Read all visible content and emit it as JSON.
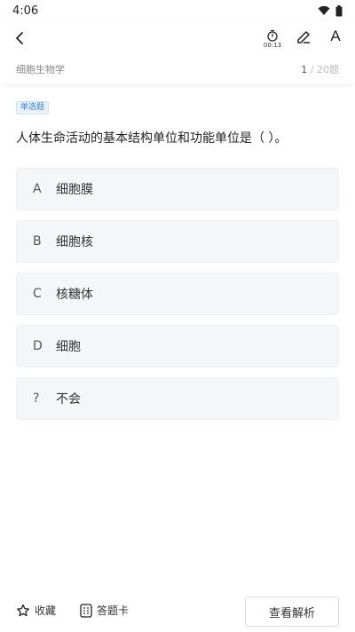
{
  "status_bar": {
    "time": "4:06"
  },
  "header": {
    "timer": "00:13",
    "font_label": "A",
    "subject": "细胞生物学",
    "progress_current": "1",
    "progress_total": " / 20题"
  },
  "question": {
    "type_label": "单选题",
    "text": "人体生命活动的基本结构单位和功能单位是（ ）。",
    "options": [
      {
        "key": "A",
        "text": "细胞膜"
      },
      {
        "key": "B",
        "text": "细胞核"
      },
      {
        "key": "C",
        "text": "核糖体"
      },
      {
        "key": "D",
        "text": "细胞"
      },
      {
        "key": "?",
        "text": "不会"
      }
    ]
  },
  "footer": {
    "favorite_label": "收藏",
    "answer_card_label": "答题卡",
    "analysis_label": "查看解析"
  }
}
